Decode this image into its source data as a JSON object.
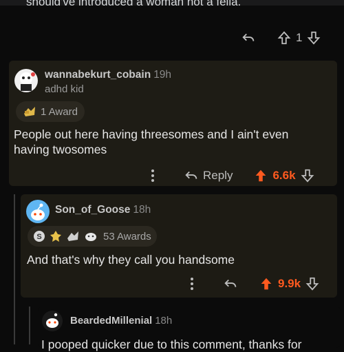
{
  "top": {
    "partial_text": "should've introduced a woman not a fella.",
    "score": "1"
  },
  "comment1": {
    "username": "wannabekurt_cobain",
    "age": "19h",
    "flair": "adhd kid",
    "award_label": "1 Award",
    "body": "People out here having threesomes and I ain't even having twosomes",
    "reply_label": "Reply",
    "score": "6.6k"
  },
  "comment2": {
    "username": "Son_of_Goose",
    "age": "18h",
    "award_label": "53 Awards",
    "body": "And that's why they call you handsome",
    "score": "9.9k"
  },
  "comment3": {
    "username": "BeardedMillenial",
    "age": "18h",
    "body_partial": "I pooped quicker due to this comment, thanks for"
  },
  "colors": {
    "upvote": "#ff5a1f",
    "card": "#1e1c15",
    "background": "#0b0b0b"
  }
}
